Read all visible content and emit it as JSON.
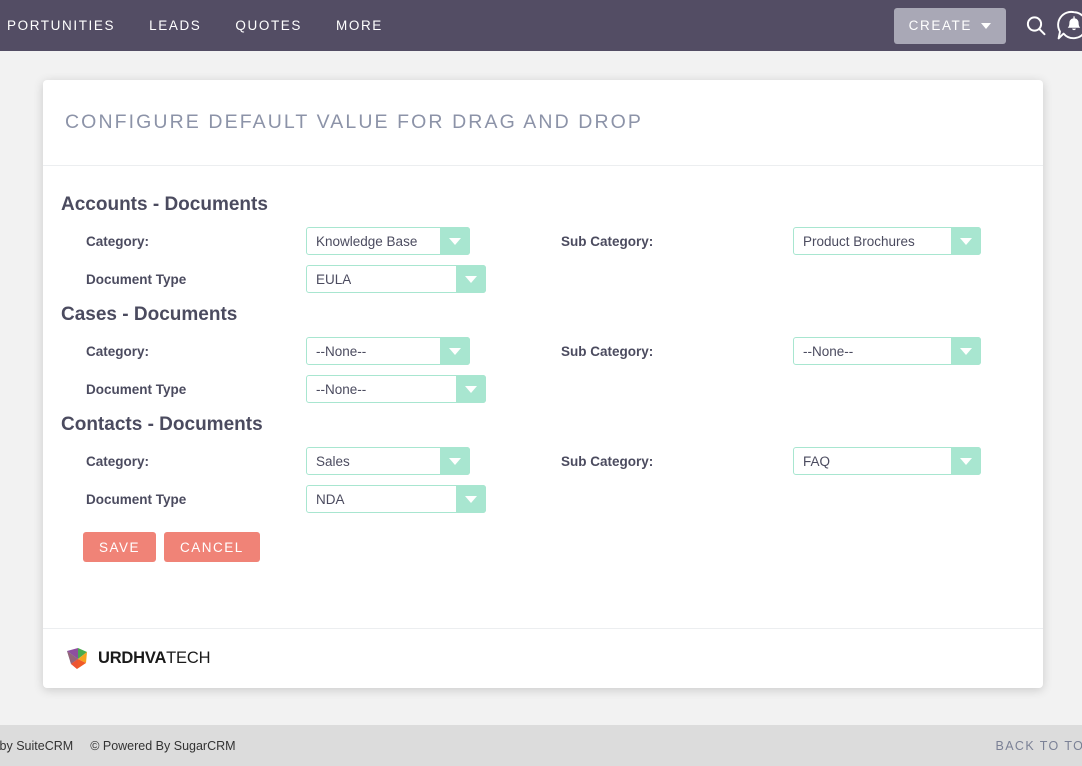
{
  "nav": {
    "links": [
      "PORTUNITIES",
      "LEADS",
      "QUOTES",
      "MORE"
    ],
    "create_label": "CREATE",
    "search_icon": "search-icon",
    "notification_icon": "bell-icon"
  },
  "header": {
    "title": "CONFIGURE DEFAULT VALUE FOR DRAG AND DROP"
  },
  "sections": [
    {
      "title": "Accounts - Documents",
      "category_label": "Category:",
      "category_value": "Knowledge Base",
      "subcategory_label": "Sub Category:",
      "subcategory_value": "Product Brochures",
      "doctype_label": "Document Type",
      "doctype_value": "EULA"
    },
    {
      "title": "Cases - Documents",
      "category_label": "Category:",
      "category_value": "--None--",
      "subcategory_label": "Sub Category:",
      "subcategory_value": "--None--",
      "doctype_label": "Document Type",
      "doctype_value": "--None--"
    },
    {
      "title": "Contacts - Documents",
      "category_label": "Category:",
      "category_value": "Sales",
      "subcategory_label": "Sub Category:",
      "subcategory_value": "FAQ",
      "doctype_label": "Document Type",
      "doctype_value": "NDA"
    }
  ],
  "actions": {
    "save_label": "SAVE",
    "cancel_label": "CANCEL"
  },
  "card_footer": {
    "logo_bold": "URDHVA",
    "logo_light": "TECH",
    "logo_icon": "urdhva-diamond-logo-icon"
  },
  "page_footer": {
    "suitecrm_text": "erchanged by SuiteCRM",
    "sugarcrm_text": "© Powered By SugarCRM",
    "back_to_top": "BACK TO TOP"
  },
  "colors": {
    "nav_bg": "#534d64",
    "accent_mint": "#a8e6d0",
    "button_coral": "#f08377",
    "title_gray": "#8c93a8",
    "text_dark": "#4b4b5f",
    "page_bg": "#f2f2f2",
    "footer_bg": "#dcdcdc"
  }
}
